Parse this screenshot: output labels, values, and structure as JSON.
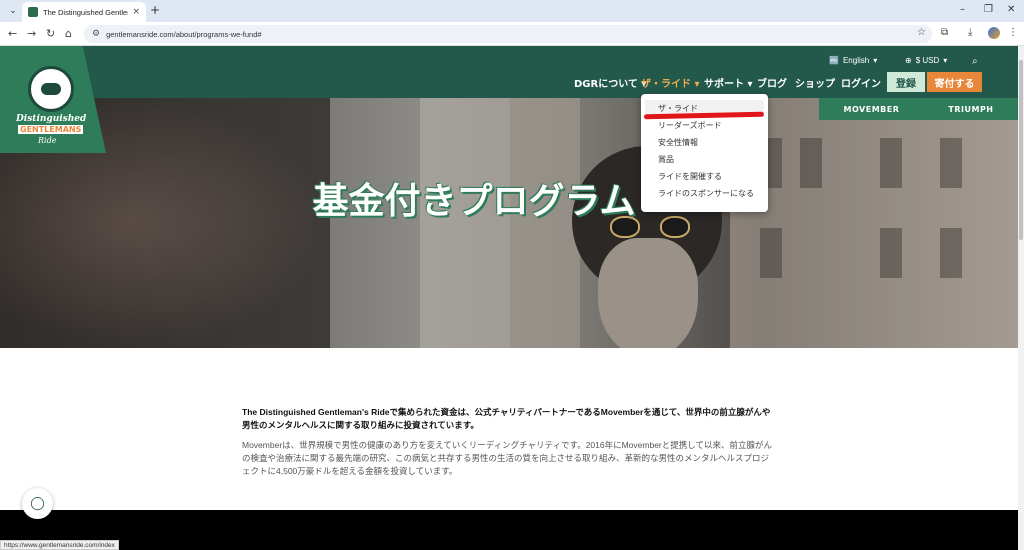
{
  "browser": {
    "tab_title": "The Distinguished Gentleman's",
    "tab_close": "×",
    "new_tab": "+",
    "url": "gentlemansride.com/about/programs-we-fund#",
    "status_url": "https://www.gentlemansride.com/index",
    "window_controls": [
      "–",
      "❐",
      "✕"
    ]
  },
  "logo": {
    "line1": "Distinguished",
    "line2": "GENTLEMANS",
    "line3": "Ride"
  },
  "topbar": {
    "language": "English",
    "currency": "$ USD"
  },
  "nav": {
    "about": "DGRについて",
    "ride": "ザ・ライド",
    "support": "サポート",
    "blog": "ブログ",
    "shop": "ショップ",
    "login": "ログイン",
    "register": "登録",
    "donate": "寄付する"
  },
  "dropdown": [
    "ザ・ライド",
    "リーダーズボード",
    "安全性情報",
    "賞品",
    "ライドを開催する",
    "ライドのスポンサーになる"
  ],
  "sponsors": [
    "MOVEMBER",
    "TRIUMPH"
  ],
  "hero": {
    "title": "基金付きプログラム"
  },
  "content": {
    "lead": "The Distinguished Gentleman's Rideで集められた資金は、公式チャリティパートナーであるMovemberを通じて、世界中の前立腺がんや男性のメンタルヘルスに関する取り組みに投資されています。",
    "body": "Movemberは、世界規模で男性の健康のあり方を変えていくリーディングチャリティです。2016年にMovemberと提携して以来、前立腺がんの検査や治療法に関する最先端の研究、この病気と共存する男性の生活の質を向上させる取り組み、革新的な男性のメンタルヘルスプロジェクトに4,500万豪ドルを超える金額を投資しています。"
  },
  "colors": {
    "header": "#23594b",
    "logo_bg": "#2e7c5a",
    "accent": "#e8873a",
    "login_bg": "#cfe9d9",
    "highlight": "#e0161b"
  }
}
